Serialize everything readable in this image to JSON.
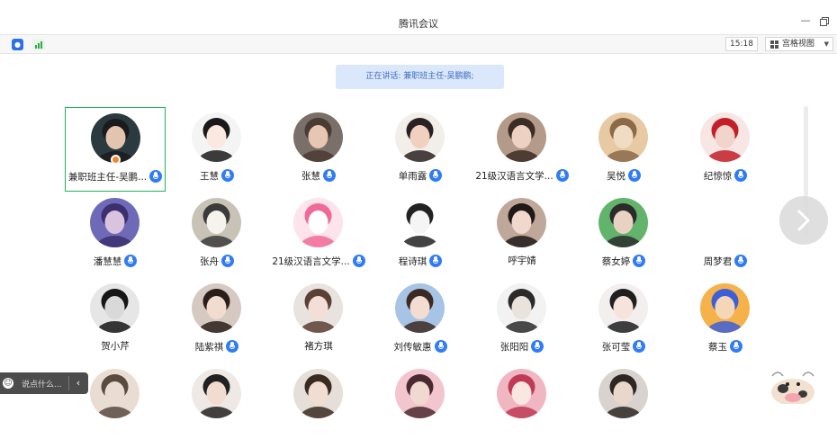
{
  "window": {
    "title": "腾讯会议"
  },
  "toolbar": {
    "clock": "15:18",
    "view_label": "宫格视图"
  },
  "speaking_banner": "正在讲话: 兼职班主任-吴鹏鹏;",
  "chat": {
    "placeholder": "说点什么..."
  },
  "colors": {
    "accent": "#2f7cf6",
    "active_border": "#1fb35b",
    "banner_bg": "#dbe7fb"
  },
  "participants": [
    {
      "name": "兼职班主任-吴鹏...",
      "mic": true,
      "active": true,
      "host": true,
      "avatar": "man-face"
    },
    {
      "name": "王慧",
      "mic": true,
      "avatar": "anime-girl"
    },
    {
      "name": "张慧",
      "mic": true,
      "avatar": "girl-photo"
    },
    {
      "name": "单雨露",
      "mic": true,
      "avatar": "girl-flowers"
    },
    {
      "name": "21级汉语言文学...",
      "mic": true,
      "avatar": "girl-hands"
    },
    {
      "name": "吴悦",
      "mic": true,
      "avatar": "puppy"
    },
    {
      "name": "纪惊惊",
      "mic": true,
      "avatar": "red-anime"
    },
    {
      "name": "潘慧慧",
      "mic": true,
      "avatar": "purple-portrait"
    },
    {
      "name": "张舟",
      "mic": true,
      "avatar": "white-dog"
    },
    {
      "name": "21级汉语言文学...",
      "mic": true,
      "avatar": "hello-kitty"
    },
    {
      "name": "程诗琪",
      "mic": true,
      "avatar": "kuromi"
    },
    {
      "name": "呼宇婧",
      "mic": false,
      "avatar": "girl-portrait"
    },
    {
      "name": "蔡女婷",
      "mic": true,
      "avatar": "green-photo"
    },
    {
      "name": "周梦君",
      "mic": true,
      "avatar": "blank"
    },
    {
      "name": "贺小芹",
      "mic": false,
      "avatar": "bw-girl"
    },
    {
      "name": "陆紫祺",
      "mic": true,
      "avatar": "girl-dark-hair"
    },
    {
      "name": "褚方琪",
      "mic": false,
      "avatar": "girl-light"
    },
    {
      "name": "刘传敏惠",
      "mic": true,
      "avatar": "girl-hat"
    },
    {
      "name": "张阳阳",
      "mic": true,
      "avatar": "anime-sketch"
    },
    {
      "name": "张可莹",
      "mic": true,
      "avatar": "girl-pale"
    },
    {
      "name": "蔡玉",
      "mic": true,
      "avatar": "cartoon-glasses"
    },
    {
      "name": "",
      "mic": false,
      "avatar": "partial-1"
    },
    {
      "name": "",
      "mic": false,
      "avatar": "partial-2"
    },
    {
      "name": "",
      "mic": false,
      "avatar": "partial-3"
    },
    {
      "name": "",
      "mic": false,
      "avatar": "partial-4"
    },
    {
      "name": "",
      "mic": false,
      "avatar": "partial-5"
    },
    {
      "name": "",
      "mic": false,
      "avatar": "partial-6"
    }
  ]
}
